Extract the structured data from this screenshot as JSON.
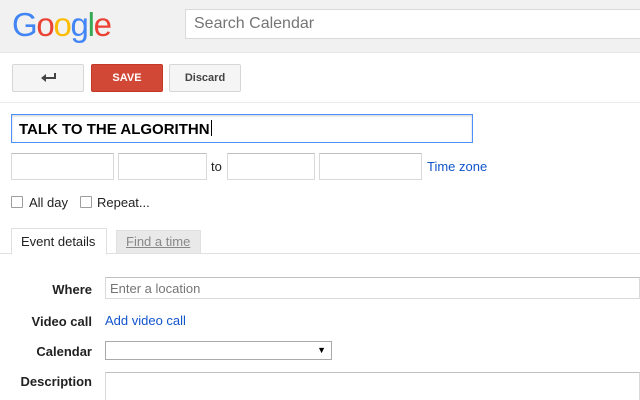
{
  "header": {
    "logo": {
      "letters": [
        "G",
        "o",
        "o",
        "g",
        "l",
        "e"
      ],
      "colors": [
        "#4285f4",
        "#ea4335",
        "#fbbc05",
        "#4285f4",
        "#34a853",
        "#ea4335"
      ]
    },
    "search": {
      "placeholder": "Search Calendar"
    }
  },
  "toolbar": {
    "back_icon": "back-arrow-icon",
    "save_label": "SAVE",
    "discard_label": "Discard",
    "colors": {
      "save_bg": "#d14836"
    }
  },
  "event": {
    "title_value": "TALK TO THE ALGORITHN",
    "start_date": "",
    "start_time": "",
    "to_label": "to",
    "end_time": "",
    "end_date": "",
    "timezone_label": "Time zone",
    "all_day_label": "All day",
    "all_day_checked": false,
    "repeat_label": "Repeat...",
    "repeat_checked": false
  },
  "tabs": [
    {
      "label": "Event details",
      "active": true
    },
    {
      "label": "Find a time",
      "active": false
    }
  ],
  "details": {
    "where_label": "Where",
    "where_placeholder": "Enter a location",
    "video_label": "Video call",
    "video_link": "Add video call",
    "calendar_label": "Calendar",
    "calendar_value": "",
    "description_label": "Description"
  },
  "accent_colors": {
    "link": "#1155cc",
    "focus": "#4d90fe"
  }
}
